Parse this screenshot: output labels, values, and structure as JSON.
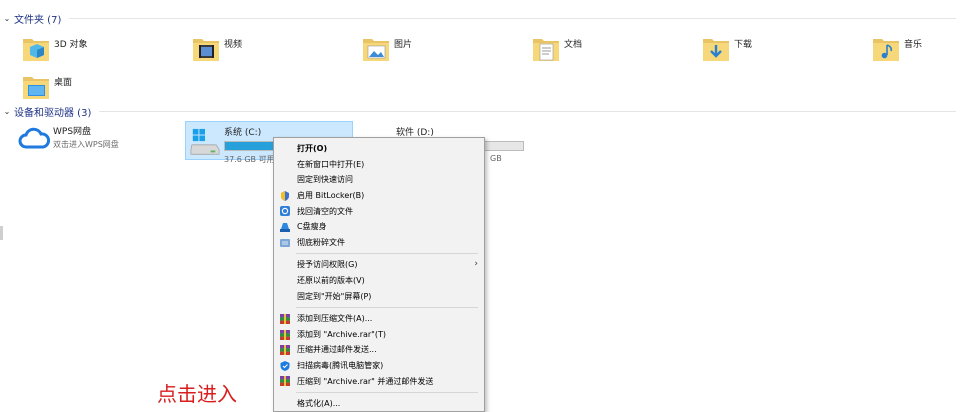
{
  "folders_header": "文件夹 (7)",
  "folders": [
    {
      "name": "3D 对象",
      "icon": "3d-objects-folder-icon"
    },
    {
      "name": "视频",
      "icon": "videos-folder-icon"
    },
    {
      "name": "图片",
      "icon": "pictures-folder-icon"
    },
    {
      "name": "文档",
      "icon": "documents-folder-icon"
    },
    {
      "name": "下载",
      "icon": "downloads-folder-icon"
    },
    {
      "name": "音乐",
      "icon": "music-folder-icon"
    },
    {
      "name": "桌面",
      "icon": "desktop-folder-icon"
    }
  ],
  "devices_header": "设备和驱动器 (3)",
  "wps": {
    "title": "WPS网盘",
    "subtitle": "双击进入WPS网盘"
  },
  "drives": [
    {
      "name": "系统 (C:)",
      "free_text": "37.6 GB 可用",
      "used_fraction": 0.62
    },
    {
      "name": "软件 (D:)",
      "free_text": "GB",
      "used_fraction": 0.4
    }
  ],
  "context_menu": {
    "groups": [
      [
        {
          "label": "打开(O)",
          "bold": true,
          "icon": ""
        },
        {
          "label": "在新窗口中打开(E)",
          "icon": ""
        },
        {
          "label": "固定到快速访问",
          "icon": ""
        },
        {
          "label": "启用 BitLocker(B)",
          "icon": "shield-icon"
        },
        {
          "label": "找回清空的文件",
          "icon": "recover-icon"
        },
        {
          "label": "C盘瘦身",
          "icon": "disk-clean-icon"
        },
        {
          "label": "彻底粉碎文件",
          "icon": "shred-icon"
        }
      ],
      [
        {
          "label": "授予访问权限(G)",
          "icon": "",
          "submenu": true
        },
        {
          "label": "还原以前的版本(V)",
          "icon": ""
        },
        {
          "label": "固定到\"开始\"屏幕(P)",
          "icon": ""
        }
      ],
      [
        {
          "label": "添加到压缩文件(A)...",
          "icon": "winrar-icon"
        },
        {
          "label": "添加到 \"Archive.rar\"(T)",
          "icon": "winrar-icon"
        },
        {
          "label": "压缩并通过邮件发送...",
          "icon": "winrar-icon"
        },
        {
          "label": "扫描病毒(腾讯电脑管家)",
          "icon": "antivirus-icon"
        },
        {
          "label": "压缩到 \"Archive.rar\" 并通过邮件发送",
          "icon": "winrar-icon"
        }
      ],
      [
        {
          "label": "格式化(A)...",
          "icon": ""
        }
      ]
    ]
  },
  "annotation": "点击进入",
  "colors": {
    "header": "#1e3287",
    "selection": "#cce8ff",
    "bar_fill": "#26a0da",
    "annotation": "#d81e1e"
  }
}
